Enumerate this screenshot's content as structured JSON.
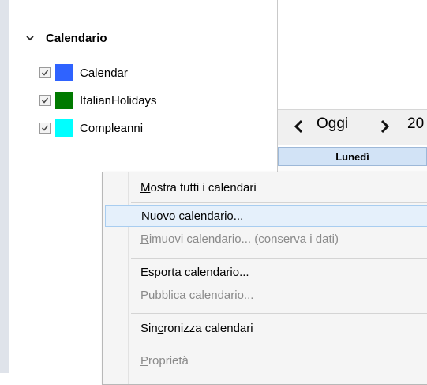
{
  "calendar_list": {
    "section_title": "Calendario",
    "items": [
      {
        "name": "Calendar",
        "checked": true,
        "color": "#2f63ff"
      },
      {
        "name": "ItalianHolidays",
        "checked": true,
        "color": "#007a00"
      },
      {
        "name": "Compleanni",
        "checked": true,
        "color": "#00ffff"
      }
    ]
  },
  "nav": {
    "today_label": "Oggi",
    "date_text": "20"
  },
  "day_header": "Lunedì",
  "context_menu": {
    "items": [
      {
        "pre": "",
        "key": "M",
        "post": "ostra tutti i calendari",
        "enabled": true
      },
      {
        "pre": "",
        "key": "N",
        "post": "uovo calendario...",
        "enabled": true,
        "highlighted": true
      },
      {
        "pre": "",
        "key": "R",
        "post": "imuovi calendario... (conserva i dati)",
        "enabled": false
      },
      {
        "pre": "E",
        "key": "s",
        "post": "porta calendario...",
        "enabled": true
      },
      {
        "pre": "P",
        "key": "u",
        "post": "bblica calendario...",
        "enabled": false
      },
      {
        "pre": "Sin",
        "key": "c",
        "post": "ronizza calendari",
        "enabled": true
      },
      {
        "pre": "",
        "key": "P",
        "post": "roprietà",
        "enabled": false
      }
    ]
  },
  "colors": {
    "hover_bg": "#e5f0fb",
    "hover_border": "#a8cdf0",
    "day_header_bg": "#d2e3f6"
  }
}
